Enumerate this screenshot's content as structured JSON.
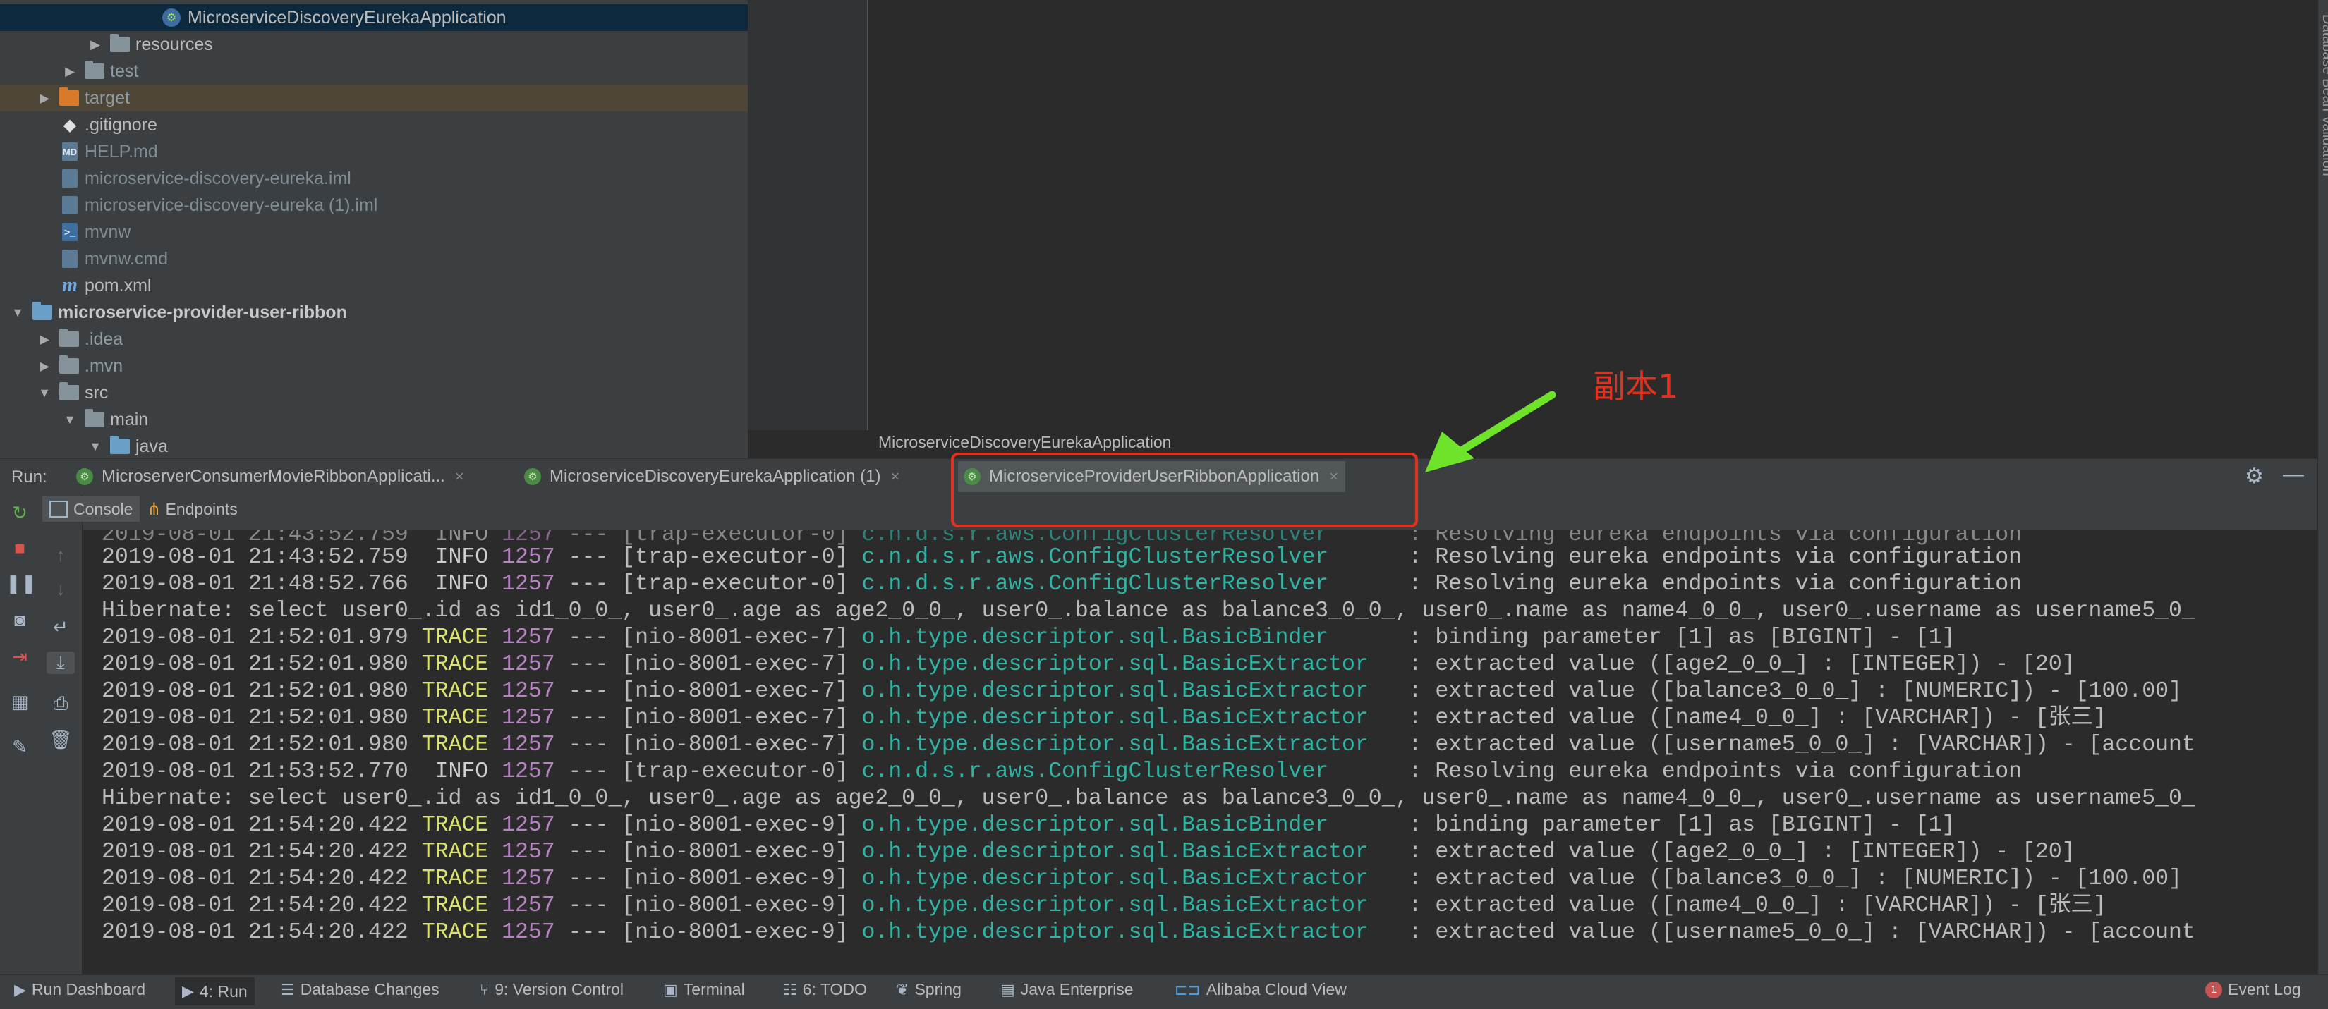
{
  "project_tree": {
    "items": [
      {
        "label": "MicroserviceDiscoveryEurekaApplication"
      },
      {
        "label": "resources"
      },
      {
        "label": "test"
      },
      {
        "label": "target"
      },
      {
        "label": ".gitignore"
      },
      {
        "label": "HELP.md"
      },
      {
        "label": "microservice-discovery-eureka.iml"
      },
      {
        "label": "microservice-discovery-eureka (1).iml"
      },
      {
        "label": "mvnw"
      },
      {
        "label": "mvnw.cmd"
      },
      {
        "label": "pom.xml"
      },
      {
        "label": "microservice-provider-user-ribbon"
      },
      {
        "label": ".idea"
      },
      {
        "label": ".mvn"
      },
      {
        "label": "src"
      },
      {
        "label": "main"
      },
      {
        "label": "java"
      }
    ]
  },
  "editor": {
    "breadcrumb": "MicroserviceDiscoveryEurekaApplication"
  },
  "right_strip": {
    "label": "Database  Bean Validation"
  },
  "run_panel": {
    "label": "Run:",
    "tabs": [
      {
        "label": "MicroserverConsumerMovieRibbonApplicati..."
      },
      {
        "label": "MicroserviceDiscoveryEurekaApplication (1)"
      },
      {
        "label": "MicroserviceProviderUserRibbonApplication"
      }
    ],
    "subtabs": {
      "console": "Console",
      "endpoints": "Endpoints"
    }
  },
  "console": {
    "lines": [
      {
        "ts": "2019-08-01 21:43:52.759",
        "level": " INFO",
        "pid": "1257",
        "thread": "--- [trap-executor-0]",
        "logger": "c.n.d.s.r.aws.ConfigClusterResolver     ",
        "msg": " : Resolving eureka endpoints via configuration"
      },
      {
        "ts": "2019-08-01 21:48:52.766",
        "level": " INFO",
        "pid": "1257",
        "thread": "--- [trap-executor-0]",
        "logger": "c.n.d.s.r.aws.ConfigClusterResolver     ",
        "msg": " : Resolving eureka endpoints via configuration"
      },
      {
        "text": "Hibernate: select user0_.id as id1_0_0_, user0_.age as age2_0_0_, user0_.balance as balance3_0_0_, user0_.name as name4_0_0_, user0_.username as username5_0_"
      },
      {
        "ts": "2019-08-01 21:52:01.979",
        "level": "TRACE",
        "pid": "1257",
        "thread": "--- [nio-8001-exec-7]",
        "logger": "o.h.type.descriptor.sql.BasicBinder     ",
        "msg": " : binding parameter [1] as [BIGINT] - [1]"
      },
      {
        "ts": "2019-08-01 21:52:01.980",
        "level": "TRACE",
        "pid": "1257",
        "thread": "--- [nio-8001-exec-7]",
        "logger": "o.h.type.descriptor.sql.BasicExtractor  ",
        "msg": " : extracted value ([age2_0_0_] : [INTEGER]) - [20]"
      },
      {
        "ts": "2019-08-01 21:52:01.980",
        "level": "TRACE",
        "pid": "1257",
        "thread": "--- [nio-8001-exec-7]",
        "logger": "o.h.type.descriptor.sql.BasicExtractor  ",
        "msg": " : extracted value ([balance3_0_0_] : [NUMERIC]) - [100.00]"
      },
      {
        "ts": "2019-08-01 21:52:01.980",
        "level": "TRACE",
        "pid": "1257",
        "thread": "--- [nio-8001-exec-7]",
        "logger": "o.h.type.descriptor.sql.BasicExtractor  ",
        "msg": " : extracted value ([name4_0_0_] : [VARCHAR]) - [张三]"
      },
      {
        "ts": "2019-08-01 21:52:01.980",
        "level": "TRACE",
        "pid": "1257",
        "thread": "--- [nio-8001-exec-7]",
        "logger": "o.h.type.descriptor.sql.BasicExtractor  ",
        "msg": " : extracted value ([username5_0_0_] : [VARCHAR]) - [account"
      },
      {
        "ts": "2019-08-01 21:53:52.770",
        "level": " INFO",
        "pid": "1257",
        "thread": "--- [trap-executor-0]",
        "logger": "c.n.d.s.r.aws.ConfigClusterResolver     ",
        "msg": " : Resolving eureka endpoints via configuration"
      },
      {
        "text": "Hibernate: select user0_.id as id1_0_0_, user0_.age as age2_0_0_, user0_.balance as balance3_0_0_, user0_.name as name4_0_0_, user0_.username as username5_0_"
      },
      {
        "ts": "2019-08-01 21:54:20.422",
        "level": "TRACE",
        "pid": "1257",
        "thread": "--- [nio-8001-exec-9]",
        "logger": "o.h.type.descriptor.sql.BasicBinder     ",
        "msg": " : binding parameter [1] as [BIGINT] - [1]"
      },
      {
        "ts": "2019-08-01 21:54:20.422",
        "level": "TRACE",
        "pid": "1257",
        "thread": "--- [nio-8001-exec-9]",
        "logger": "o.h.type.descriptor.sql.BasicExtractor  ",
        "msg": " : extracted value ([age2_0_0_] : [INTEGER]) - [20]"
      },
      {
        "ts": "2019-08-01 21:54:20.422",
        "level": "TRACE",
        "pid": "1257",
        "thread": "--- [nio-8001-exec-9]",
        "logger": "o.h.type.descriptor.sql.BasicExtractor  ",
        "msg": " : extracted value ([balance3_0_0_] : [NUMERIC]) - [100.00]"
      },
      {
        "ts": "2019-08-01 21:54:20.422",
        "level": "TRACE",
        "pid": "1257",
        "thread": "--- [nio-8001-exec-9]",
        "logger": "o.h.type.descriptor.sql.BasicExtractor  ",
        "msg": " : extracted value ([name4_0_0_] : [VARCHAR]) - [张三]"
      },
      {
        "ts": "2019-08-01 21:54:20.422",
        "level": "TRACE",
        "pid": "1257",
        "thread": "--- [nio-8001-exec-9]",
        "logger": "o.h.type.descriptor.sql.BasicExtractor  ",
        "msg": " : extracted value ([username5_0_0_] : [VARCHAR]) - [account"
      }
    ]
  },
  "status_bar": {
    "items": [
      {
        "label": "Run Dashboard"
      },
      {
        "label": "4: Run"
      },
      {
        "label": "Database Changes"
      },
      {
        "label": "9: Version Control"
      },
      {
        "label": "Terminal"
      },
      {
        "label": "6: TODO"
      },
      {
        "label": "Spring"
      },
      {
        "label": "Java Enterprise"
      },
      {
        "label": "Alibaba Cloud View"
      }
    ],
    "event_log": {
      "badge": "1",
      "label": "Event Log"
    }
  },
  "annotation": {
    "text": "副本1",
    "colors": {
      "box": "#e0321f",
      "arrow": "#6fe32a"
    }
  }
}
